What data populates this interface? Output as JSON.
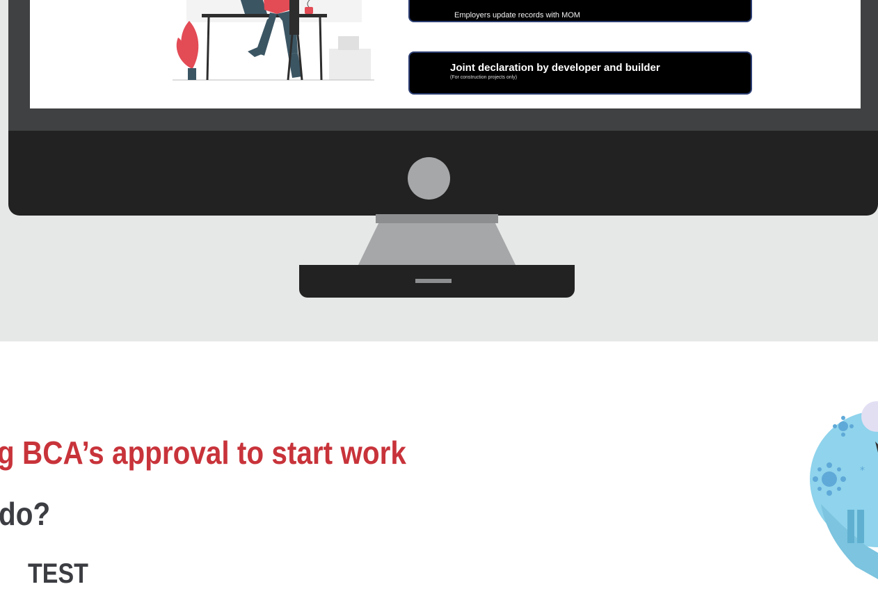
{
  "screen": {
    "step_mom_text": "Employers update records with MOM",
    "step_joint_title": "Joint declaration by developer and builder",
    "step_joint_subtitle": "(For construction projects only)"
  },
  "content": {
    "heading_red": "g BCA’s approval to start work",
    "heading_dark": "do?",
    "test_label": "TEST"
  },
  "colors": {
    "accent_red": "#c8333a",
    "text_dark": "#3b3d42",
    "monitor_dark": "#222222",
    "bezel": "#404142",
    "stand": "#a6a7a9",
    "band": "#e6e8e7"
  },
  "icons": [
    "person-at-desk-illustration",
    "virus-illustration"
  ]
}
